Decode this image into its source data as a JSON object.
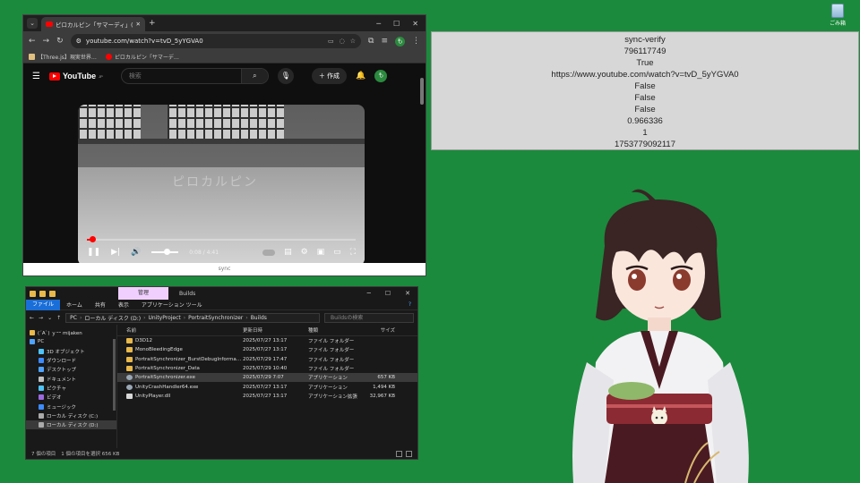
{
  "desktop": {
    "recycle_bin_label": "ごみ箱"
  },
  "sync_panel": {
    "lines": [
      "sync-verify",
      "796117749",
      "True",
      "https://www.youtube.com/watch?v=tvD_5yYGVA0",
      "False",
      "False",
      "False",
      "0.966336",
      "1",
      "1753779092117"
    ]
  },
  "browser": {
    "tab_title": "ピロカルピン「サマーディ」(バンドスコア…",
    "url": "youtube.com/watch?v=tvD_5yYGVA0",
    "profile_initial": "も",
    "bookmarks": [
      "【Three.js】現実世界…",
      "ピロカルピン「サマーデ…"
    ],
    "youtube": {
      "logo_text": "YouTube",
      "logo_region": "JP",
      "search_placeholder": "検索",
      "create_label": "作成",
      "avatar_initial": "も",
      "video_watermark": "ピロカルピン",
      "progress_fraction": 0.02,
      "volume_fraction": 0.5,
      "time_display": "0:08 / 4:41"
    },
    "status_strip_text": "sync"
  },
  "explorer": {
    "manage_tab": "管理",
    "window_title": "Builds",
    "ribbon_tabs": [
      "ファイル",
      "ホーム",
      "共有",
      "表示",
      "アプリケーション ツール"
    ],
    "breadcrumb": [
      "PC",
      "ローカル ディスク (D:)",
      "UnityProject",
      "PortraitSynchronizer",
      "Builds"
    ],
    "search_placeholder": "Buildsの検索",
    "nav_items": [
      {
        "label": "(´A`) ｙｰｰ mijaken",
        "color": "#e8b84a"
      },
      {
        "label": "PC",
        "color": "#4fa3ff"
      },
      {
        "label": "3D オブジェクト",
        "color": "#4fc3f7"
      },
      {
        "label": "ダウンロード",
        "color": "#3d8bfd"
      },
      {
        "label": "デスクトップ",
        "color": "#4fa3ff"
      },
      {
        "label": "ドキュメント",
        "color": "#c0c0c0"
      },
      {
        "label": "ピクチャ",
        "color": "#4fc3f7"
      },
      {
        "label": "ビデオ",
        "color": "#9c6ade"
      },
      {
        "label": "ミュージック",
        "color": "#3d8bfd"
      },
      {
        "label": "ローカル ディスク (C:)",
        "color": "#aaaaaa"
      },
      {
        "label": "ローカル ディスク (D:)",
        "color": "#aaaaaa"
      }
    ],
    "columns": [
      "名前",
      "更新日時",
      "種類",
      "サイズ"
    ],
    "files": [
      {
        "name": "D3D12",
        "date": "2025/07/27 13:17",
        "type": "ファイル フォルダー",
        "size": "",
        "icon": "folder"
      },
      {
        "name": "MonoBleedingEdge",
        "date": "2025/07/27 13:17",
        "type": "ファイル フォルダー",
        "size": "",
        "icon": "folder"
      },
      {
        "name": "PortraitSynchronizer_BurstDebugInforma…",
        "date": "2025/07/29 17:47",
        "type": "ファイル フォルダー",
        "size": "",
        "icon": "folder"
      },
      {
        "name": "PortraitSynchronizer_Data",
        "date": "2025/07/29 10:40",
        "type": "ファイル フォルダー",
        "size": "",
        "icon": "folder"
      },
      {
        "name": "PortraitSynchronizer.exe",
        "date": "2025/07/29 7:07",
        "type": "アプリケーション",
        "size": "657 KB",
        "icon": "exe"
      },
      {
        "name": "UnityCrashHandler64.exe",
        "date": "2025/07/27 13:17",
        "type": "アプリケーション",
        "size": "1,494 KB",
        "icon": "exe"
      },
      {
        "name": "UnityPlayer.dll",
        "date": "2025/07/27 13:17",
        "type": "アプリケーション拡張",
        "size": "32,967 KB",
        "icon": "dll"
      }
    ],
    "status": {
      "item_count": "7 個の項目",
      "selection": "1 個の項目を選択 656 KB"
    }
  }
}
